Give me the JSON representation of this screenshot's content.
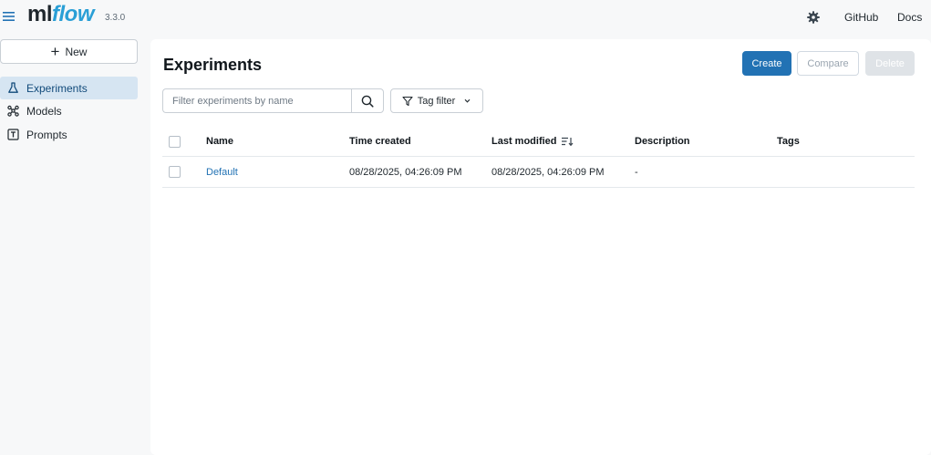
{
  "app": {
    "logo_ml": "ml",
    "logo_flow": "flow",
    "version": "3.3.0",
    "accent_color": "#2a9fd6",
    "primary_color": "#2272b4"
  },
  "topbar": {
    "settings_icon": "gear-icon",
    "github_label": "GitHub",
    "docs_label": "Docs"
  },
  "sidebar": {
    "new_label": "New",
    "items": [
      {
        "label": "Experiments",
        "icon": "flask-icon",
        "active": true
      },
      {
        "label": "Models",
        "icon": "models-icon",
        "active": false
      },
      {
        "label": "Prompts",
        "icon": "prompt-icon",
        "active": false
      }
    ]
  },
  "main": {
    "title": "Experiments",
    "create_label": "Create",
    "compare_label": "Compare",
    "delete_label": "Delete",
    "search_placeholder": "Filter experiments by name",
    "tag_filter_label": "Tag filter"
  },
  "table": {
    "columns": [
      "Name",
      "Time created",
      "Last modified",
      "Description",
      "Tags"
    ],
    "rows": [
      {
        "name": "Default",
        "time_created": "08/28/2025, 04:26:09 PM",
        "last_modified": "08/28/2025, 04:26:09 PM",
        "description": "-",
        "tags": ""
      }
    ]
  }
}
